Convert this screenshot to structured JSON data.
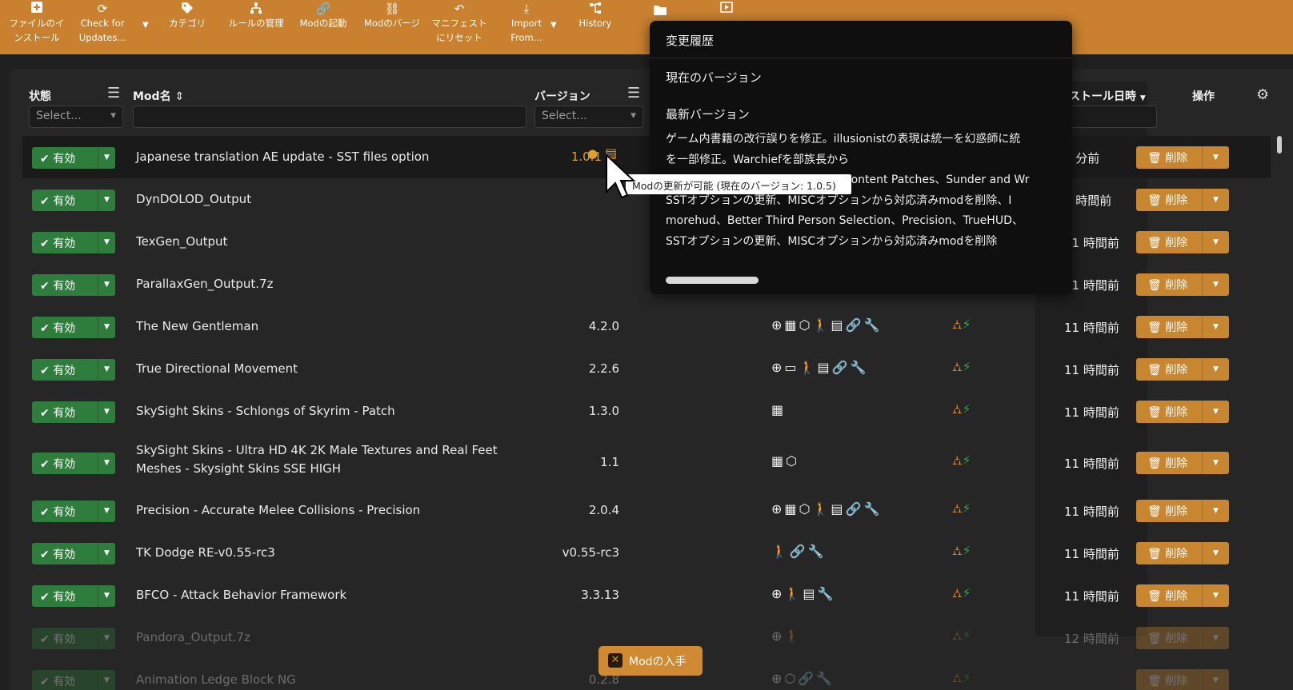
{
  "toolbar": {
    "items": [
      {
        "line1": "ファイルのイ",
        "line2": "ンストール",
        "icon": "plus-icon"
      },
      {
        "line1": "Check for",
        "line2": "Updates...",
        "icon": "refresh-icon"
      },
      {
        "line1": "カテゴリ",
        "line2": "",
        "icon": "tag-icon"
      },
      {
        "line1": "ルールの管理",
        "line2": "",
        "icon": "hierarchy-icon"
      },
      {
        "line1": "Modの起動",
        "line2": "",
        "icon": "link-icon"
      },
      {
        "line1": "Modのバージ",
        "line2": "",
        "icon": "unlink-icon"
      },
      {
        "line1": "マニフェスト",
        "line2": "にリセット",
        "icon": "undo-icon"
      },
      {
        "line1": "Import",
        "line2": "From...",
        "icon": "download-icon"
      },
      {
        "line1": "History",
        "line2": "",
        "icon": "history-icon"
      }
    ]
  },
  "header": {
    "status": "状態",
    "mod_name": "Mod名",
    "version": "バージョン",
    "install_time": "ストール日時",
    "actions": "操作",
    "select_placeholder": "Select..."
  },
  "rows": [
    {
      "name": "Japanese translation AE update - SST files option",
      "version": "1.0.1",
      "update": true,
      "categories": "",
      "time": "1 分前",
      "highlight": true
    },
    {
      "name": "DynDOLOD_Output",
      "version": "",
      "categories": "",
      "time": "6 時間前"
    },
    {
      "name": "TexGen_Output",
      "version": "",
      "categories": "",
      "time": "11 時間前"
    },
    {
      "name": "ParallaxGen_Output.7z",
      "version": "",
      "categories": "",
      "time": "11 時間前"
    },
    {
      "name": "The New Gentleman",
      "version": "4.2.0",
      "categories": "⊕▦⬡🚶▤🔗🔧",
      "time": "11 時間前",
      "rules": true
    },
    {
      "name": "True Directional Movement",
      "version": "2.2.6",
      "categories": "⊕▭🚶▤🔗🔧",
      "time": "11 時間前",
      "rules": true
    },
    {
      "name": "SkySight Skins - Schlongs of Skyrim - Patch",
      "version": "1.3.0",
      "categories": "▦",
      "time": "11 時間前",
      "rules": true
    },
    {
      "name": "SkySight Skins - Ultra HD 4K 2K Male Textures and Real Feet",
      "name2": "Meshes - Skysight Skins SSE HIGH",
      "version": "1.1",
      "categories": "▦⬡",
      "time": "11 時間前",
      "rules": true
    },
    {
      "name": "Precision - Accurate Melee Collisions - Precision",
      "version": "2.0.4",
      "categories": "⊕▦⬡🚶▤🔗🔧",
      "time": "11 時間前",
      "rules": true
    },
    {
      "name": "TK Dodge RE-v0.55-rc3",
      "version": "v0.55-rc3",
      "categories": "🚶🔗🔧",
      "time": "11 時間前",
      "rules": true
    },
    {
      "name": "BFCO - Attack Behavior Framework",
      "version": "3.3.13",
      "categories": "⊕🚶▤🔧",
      "time": "11 時間前",
      "rules": true
    },
    {
      "name": "Pandora_Output.7z",
      "version": "",
      "categories": "⊕🚶",
      "time": "12 時間前",
      "rules": true,
      "fade": true
    },
    {
      "name": "Animation Ledge Block NG",
      "version": "0.2.8",
      "categories": "⊕⬡🔗🔧",
      "time": "",
      "rules": true,
      "fade": true
    }
  ],
  "row_labels": {
    "enabled": "有効",
    "delete": "削除"
  },
  "popup": {
    "title": "変更履歴",
    "current_version": "現在のバージョン",
    "latest_version": "最新バージョン",
    "lines": [
      "ゲーム内書籍の改行誤りを修正。illusionistの表現は統一を幻惑師に統",
      "を一部修正。Warchiefを部族長から",
      "Unofficial Skyrim Creation Club Content Patches、Sunder and Wr",
      "SSTオプションの更新、MISCオプションから対応済みmodを削除、I",
      "morehud、Better Third Person Selection、Precision、TrueHUD、",
      "SSTオプションの更新、MISCオプションから対応済みmodを削除"
    ]
  },
  "tooltip": "Modの更新が可能 (現在のバージョン: 1.0.5)",
  "get_mods_button": "Modの入手",
  "colors": {
    "toolbar": "#c9802f",
    "enable": "#2f7d3c",
    "delete": "#c98631",
    "update_version": "#e0a030"
  }
}
